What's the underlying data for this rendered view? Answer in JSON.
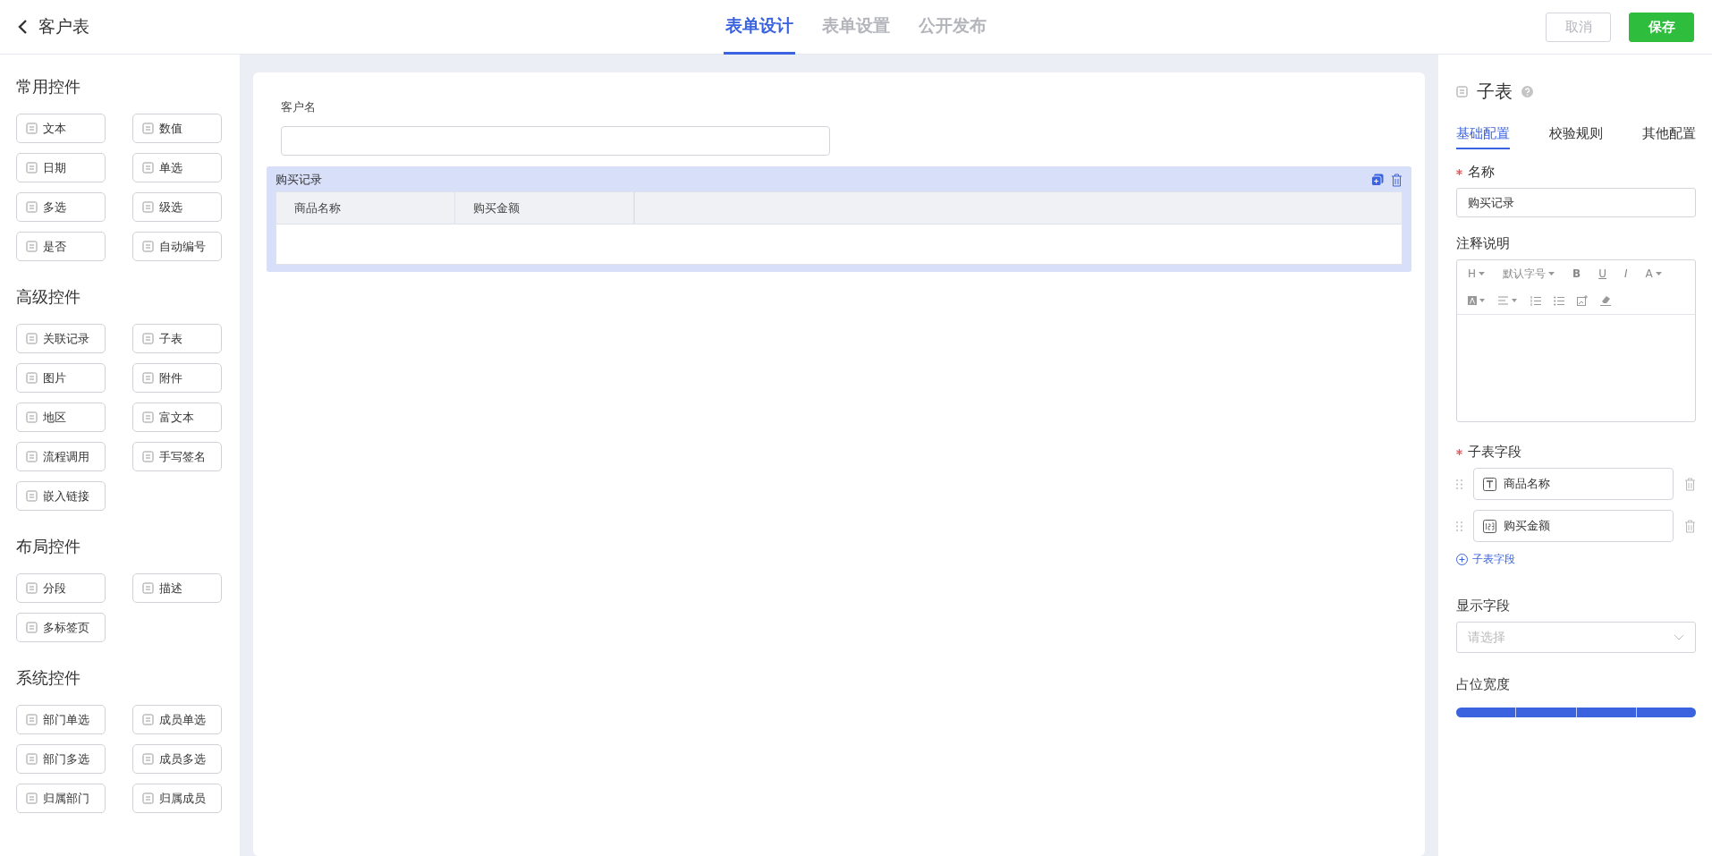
{
  "header": {
    "title": "客户表",
    "tabs": [
      {
        "label": "表单设计",
        "selected": true
      },
      {
        "label": "表单设置",
        "selected": false
      },
      {
        "label": "公开发布",
        "selected": false
      }
    ],
    "buttons": [
      {
        "label": "取消",
        "kind": "secondary"
      },
      {
        "label": "保存",
        "kind": "primary"
      }
    ]
  },
  "palette": [
    {
      "title": "常用控件",
      "items": [
        "文本",
        "数值",
        "日期",
        "单选",
        "多选",
        "级选",
        "是否",
        "自动编号"
      ]
    },
    {
      "title": "高级控件",
      "items": [
        "关联记录",
        "子表",
        "图片",
        "附件",
        "地区",
        "富文本",
        "流程调用",
        "手写签名",
        "嵌入链接"
      ]
    },
    {
      "title": "布局控件",
      "items": [
        "分段",
        "描述",
        "多标签页"
      ]
    },
    {
      "title": "系统控件",
      "items": [
        "部门单选",
        "成员单选",
        "部门多选",
        "成员多选",
        "归属部门",
        "归属成员"
      ]
    }
  ],
  "canvas": {
    "fields": [
      {
        "kind": "text",
        "label": "客户名"
      },
      {
        "kind": "subtable",
        "label": "购买记录",
        "columns": [
          "商品名称",
          "购买金额"
        ]
      }
    ]
  },
  "properties": {
    "title": "子表",
    "tabs": [
      {
        "label": "基础配置",
        "selected": true
      },
      {
        "label": "校验规则",
        "selected": false
      },
      {
        "label": "其他配置",
        "selected": false
      }
    ],
    "name": {
      "label": "名称",
      "required": true,
      "value": "购买记录"
    },
    "note": {
      "label": "注释说明",
      "toolbar": [
        {
          "label": "H",
          "caret": true
        },
        {
          "label": "默认字号",
          "caret": true
        },
        {
          "label": "B",
          "caret": false
        },
        {
          "label": "U",
          "caret": false
        },
        {
          "label": "I",
          "caret": false
        },
        {
          "label": "A",
          "caret": true
        }
      ]
    },
    "subfields": {
      "label": "子表字段",
      "required": true,
      "items": [
        {
          "kind": "text",
          "label": "商品名称"
        },
        {
          "kind": "number",
          "label": "购买金额"
        }
      ],
      "add_label": "子表字段"
    },
    "display": {
      "label": "显示字段",
      "placeholder": "请选择"
    },
    "width": {
      "label": "占位宽度",
      "segments": [
        {
          "selected": true
        },
        {
          "selected": true
        },
        {
          "selected": true
        },
        {
          "selected": true
        }
      ]
    }
  }
}
